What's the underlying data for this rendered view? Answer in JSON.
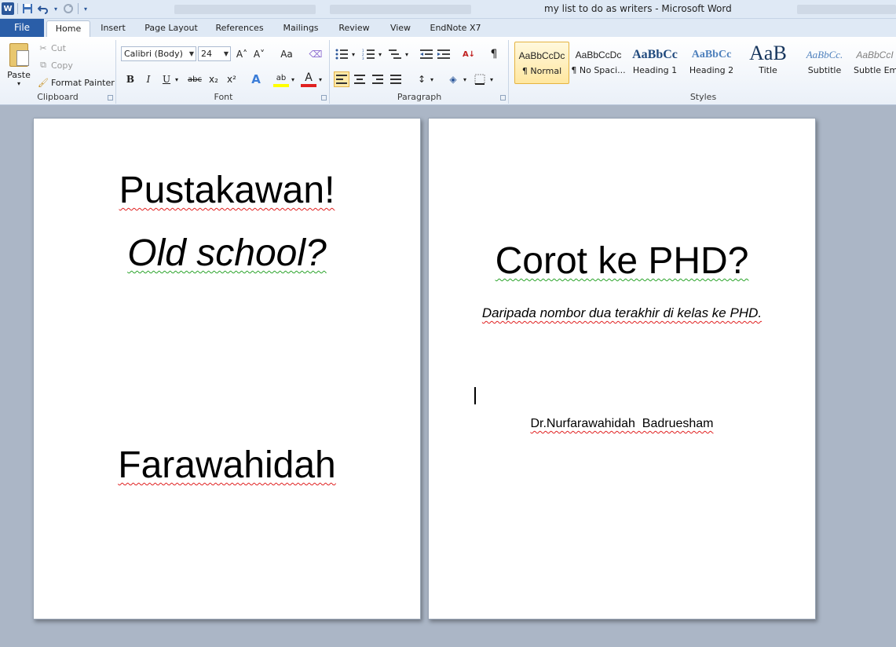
{
  "window": {
    "title": "my list to do as writers  -  Microsoft Word"
  },
  "qat": {
    "app_icon": "word-icon",
    "app_letter": "W",
    "save_icon": "save-icon",
    "undo_icon": "undo-icon",
    "redo_icon": "redo-icon"
  },
  "tabs": {
    "file": "File",
    "items": [
      "Home",
      "Insert",
      "Page Layout",
      "References",
      "Mailings",
      "Review",
      "View",
      "EndNote X7"
    ]
  },
  "clipboard": {
    "paste": "Paste",
    "cut": "Cut",
    "copy": "Copy",
    "format_painter": "Format Painter",
    "label": "Clipboard"
  },
  "font": {
    "name": "Calibri (Body)",
    "size": "24",
    "label": "Font",
    "bold": "B",
    "italic": "I",
    "underline": "U",
    "strike": "abc",
    "subscript": "x₂",
    "superscript": "x²",
    "grow": "A˄",
    "shrink": "A˅",
    "change_case": "Aa",
    "text_effects": "A",
    "highlight": "ab",
    "font_color": "A"
  },
  "paragraph": {
    "label": "Paragraph",
    "pilcrow": "¶"
  },
  "styles": {
    "label": "Styles",
    "items": [
      {
        "sample": "AaBbCcDc",
        "name": "¶ Normal"
      },
      {
        "sample": "AaBbCcDc",
        "name": "¶ No Spaci..."
      },
      {
        "sample": "AaBbCc",
        "name": "Heading 1"
      },
      {
        "sample": "AaBbCc",
        "name": "Heading 2"
      },
      {
        "sample": "AaB",
        "name": "Title"
      },
      {
        "sample": "AaBbCc.",
        "name": "Subtitle"
      },
      {
        "sample": "AaBbCcI",
        "name": "Subtle Em..."
      }
    ]
  },
  "document": {
    "page1": {
      "line1": "Pustakawan!",
      "line2": "Old school?",
      "line3": "Farawahidah"
    },
    "page2": {
      "title": "Corot ke PHD?",
      "subtitle": "Daripada nombor dua terakhir di kelas ke PHD.",
      "author": "Dr.Nurfarawahidah  Badruesham"
    }
  },
  "colors": {
    "file_tab": "#2a5ea8",
    "ribbon_bg": "#eaf0f8",
    "workspace": "#abb6c6",
    "spell_error": "#e02020",
    "grammar_error": "#2aa32a"
  }
}
